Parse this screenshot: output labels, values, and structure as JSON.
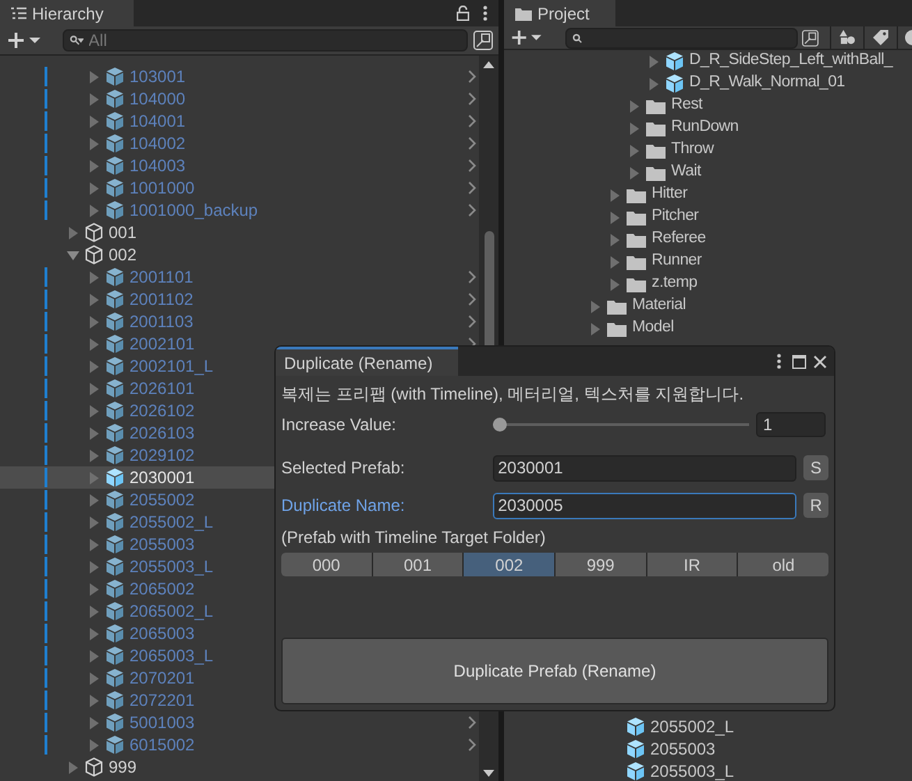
{
  "hierarchy": {
    "title": "Hierarchy",
    "search": {
      "placeholder": "All"
    },
    "items": [
      {
        "children": [
          {
            "label": "103001",
            "kind": "prefab",
            "expanded": false,
            "selected": false,
            "chevron": true
          },
          {
            "label": "104000",
            "kind": "prefab",
            "expanded": false,
            "selected": false,
            "chevron": true
          },
          {
            "label": "104001",
            "kind": "prefab",
            "expanded": false,
            "selected": false,
            "chevron": true
          },
          {
            "label": "104002",
            "kind": "prefab",
            "expanded": false,
            "selected": false,
            "chevron": true
          },
          {
            "label": "104003",
            "kind": "prefab",
            "expanded": false,
            "selected": false,
            "chevron": true
          },
          {
            "label": "1001000",
            "kind": "prefab",
            "expanded": false,
            "selected": false,
            "chevron": true
          },
          {
            "label": "1001000_backup",
            "kind": "prefab",
            "expanded": false,
            "selected": false,
            "chevron": true
          }
        ]
      },
      {
        "label": "001",
        "kind": "object",
        "expanded": false,
        "selected": false
      },
      {
        "label": "002",
        "kind": "object",
        "expanded": true,
        "selected": false,
        "children": [
          {
            "label": "2001101",
            "kind": "prefab",
            "expanded": false,
            "selected": false,
            "chevron": true
          },
          {
            "label": "2001102",
            "kind": "prefab",
            "expanded": false,
            "selected": false,
            "chevron": true
          },
          {
            "label": "2001103",
            "kind": "prefab",
            "expanded": false,
            "selected": false,
            "chevron": true
          },
          {
            "label": "2002101",
            "kind": "prefab",
            "expanded": false,
            "selected": false,
            "chevron": true
          },
          {
            "label": "2002101_L",
            "kind": "prefab",
            "expanded": false,
            "selected": false,
            "chevron": false
          },
          {
            "label": "2026101",
            "kind": "prefab",
            "expanded": false,
            "selected": false,
            "chevron": false
          },
          {
            "label": "2026102",
            "kind": "prefab",
            "expanded": false,
            "selected": false,
            "chevron": false
          },
          {
            "label": "2026103",
            "kind": "prefab",
            "expanded": false,
            "selected": false,
            "chevron": false
          },
          {
            "label": "2029102",
            "kind": "prefab",
            "expanded": false,
            "selected": false,
            "chevron": false
          },
          {
            "label": "2030001",
            "kind": "prefab",
            "expanded": false,
            "selected": true,
            "chevron": false
          },
          {
            "label": "2055002",
            "kind": "prefab",
            "expanded": false,
            "selected": false,
            "chevron": false
          },
          {
            "label": "2055002_L",
            "kind": "prefab",
            "expanded": false,
            "selected": false,
            "chevron": false
          },
          {
            "label": "2055003",
            "kind": "prefab",
            "expanded": false,
            "selected": false,
            "chevron": false
          },
          {
            "label": "2055003_L",
            "kind": "prefab",
            "expanded": false,
            "selected": false,
            "chevron": false
          },
          {
            "label": "2065002",
            "kind": "prefab",
            "expanded": false,
            "selected": false,
            "chevron": false
          },
          {
            "label": "2065002_L",
            "kind": "prefab",
            "expanded": false,
            "selected": false,
            "chevron": false
          },
          {
            "label": "2065003",
            "kind": "prefab",
            "expanded": false,
            "selected": false,
            "chevron": false
          },
          {
            "label": "2065003_L",
            "kind": "prefab",
            "expanded": false,
            "selected": false,
            "chevron": false
          },
          {
            "label": "2070201",
            "kind": "prefab",
            "expanded": false,
            "selected": false,
            "chevron": false
          },
          {
            "label": "2072201",
            "kind": "prefab",
            "expanded": false,
            "selected": false,
            "chevron": false
          },
          {
            "label": "5001003",
            "kind": "prefab",
            "expanded": false,
            "selected": false,
            "chevron": true
          },
          {
            "label": "6015002",
            "kind": "prefab",
            "expanded": false,
            "selected": false,
            "chevron": true
          }
        ]
      },
      {
        "label": "999",
        "kind": "object",
        "expanded": false,
        "selected": false
      }
    ]
  },
  "project": {
    "title": "Project",
    "items": [
      {
        "children": [
          {
            "children": [
              {
                "children": [
                  {
                    "label": "D_R_SideStep_Left_withBall_",
                    "kind": "prefab",
                    "expanded": false
                  },
                  {
                    "label": "D_R_Walk_Normal_01",
                    "kind": "prefab",
                    "expanded": false
                  }
                ]
              },
              {
                "label": "Rest",
                "kind": "folder",
                "expanded": false
              },
              {
                "label": "RunDown",
                "kind": "folder",
                "expanded": false
              },
              {
                "label": "Throw",
                "kind": "folder",
                "expanded": false
              },
              {
                "label": "Wait",
                "kind": "folder",
                "expanded": false
              }
            ]
          },
          {
            "label": "Hitter",
            "kind": "folder",
            "expanded": false
          },
          {
            "label": "Pitcher",
            "kind": "folder",
            "expanded": false
          },
          {
            "label": "Referee",
            "kind": "folder",
            "expanded": false
          },
          {
            "label": "Runner",
            "kind": "folder",
            "expanded": false
          },
          {
            "label": "z.temp",
            "kind": "folder",
            "expanded": false
          }
        ]
      },
      {
        "label": "Material",
        "kind": "folder",
        "expanded": false
      },
      {
        "label": "Model",
        "kind": "folder",
        "expanded": false
      }
    ],
    "lower_items": [
      "2055002_L",
      "2055003",
      "2055003_L"
    ]
  },
  "dialog": {
    "title": "Duplicate (Rename)",
    "description": "복제는 프리팹 (with Timeline), 메터리얼, 텍스처를 지원합니다.",
    "increase_value": {
      "label": "Increase Value:",
      "level": 0,
      "value": "1"
    },
    "selected_prefab": {
      "label": "Selected Prefab:",
      "value": "2030001",
      "button": "S",
      "focused": false
    },
    "duplicate_name": {
      "label": "Duplicate Name:",
      "value": "2030005",
      "button": "R",
      "focused": true
    },
    "folder_label": "(Prefab with Timeline Target Folder)",
    "folders": [
      {
        "label": "000",
        "selected": false
      },
      {
        "label": "001",
        "selected": false
      },
      {
        "label": "002",
        "selected": true
      },
      {
        "label": "999",
        "selected": false
      },
      {
        "label": "IR",
        "selected": false
      },
      {
        "label": "old",
        "selected": false
      }
    ],
    "action_button": "Duplicate Prefab (Rename)"
  }
}
